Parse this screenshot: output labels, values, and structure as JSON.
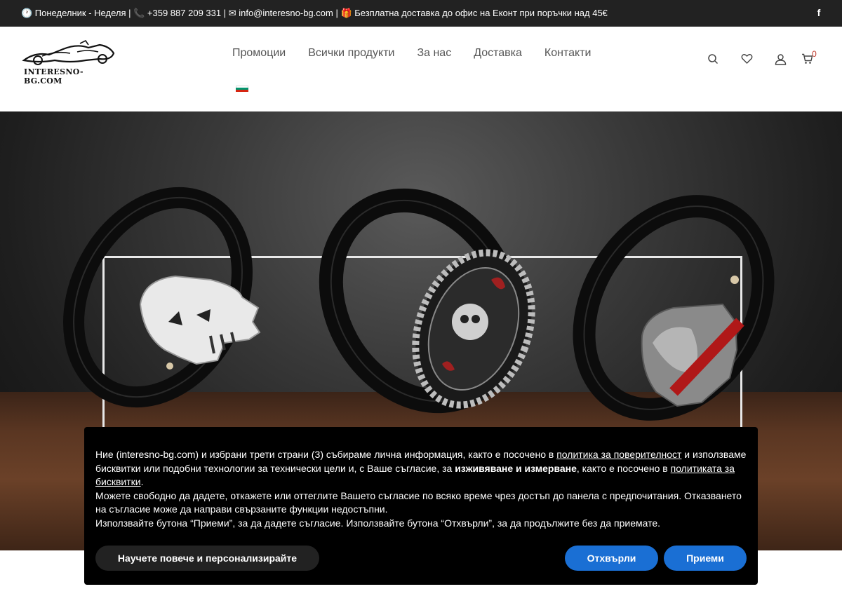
{
  "topbar": {
    "hours": "🕐 Понеделник - Неделя",
    "phone": "📞 +359 887 209 331",
    "email": "✉ info@interesno-bg.com",
    "promo": "🎁 Безплатна доставка до офис на Еконт при поръчки над 45€",
    "separator": " | ",
    "facebook_icon": "facebook-icon"
  },
  "header": {
    "logo_text": "INTERESNO-BG.COM",
    "nav": [
      "Промоции",
      "Всички продукти",
      "За нас",
      "Доставка",
      "Контакти"
    ],
    "language_flag": "bulgarian-flag-icon",
    "cart_count": "0"
  },
  "colors": {
    "topbar_bg": "#222222",
    "accent_blue": "#1a6fd4",
    "cart_badge": "#c0392b",
    "banner_bg": "#000000"
  },
  "cookie": {
    "p1_a": "Ние (interesno-bg.com) и избрани трети страни (3) събираме лична информация, както е посочено в ",
    "p1_link1": "политика за поверителност",
    "p1_b": " и използваме бисквитки или подобни технологии за технически цели и, с Ваше съгласие, за ",
    "p1_bold": "изживяване и измерване",
    "p1_c": ", както е посочено в ",
    "p1_link2": "политиката за бисквитки",
    "p1_d": ".",
    "p2": "Можете свободно да дадете, откажете или оттеглите Вашето съгласие по всяко време чрез достъп до панела с предпочитания. Отказването на съгласие може да направи свързаните функции недостъпни.",
    "p3": "Използвайте бутона “Приеми”, за да дадете съгласие. Използвайте бутона “Отхвърли”, за да продължите без да приемате.",
    "learn_more": "Научете повече и персонализирайте",
    "reject": "Отхвърли",
    "accept": "Приеми"
  }
}
